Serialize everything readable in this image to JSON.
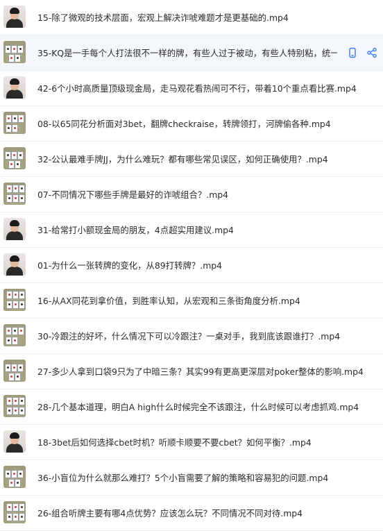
{
  "items": [
    {
      "title": "15-除了微观的技术层面，宏观上解决诈唬难题才是更基础的.mp4",
      "thumb": "presenter"
    },
    {
      "title": "35-KQ是一手每个人打法很不一样的牌，有些人过于被动，有些人特别粘，统一...",
      "thumb": "cards",
      "active": true
    },
    {
      "title": "42-6个小时高质量顶级现金局，走马观花看热闹可不行，带着10个重点看比赛.mp4",
      "thumb": "presenter"
    },
    {
      "title": "08-以65同花分析面对3bet，翻牌checkraise，转牌领打，河牌偷各种.mp4",
      "thumb": "cards"
    },
    {
      "title": "32-公认最难手牌JJ，为什么难玩？都有哪些常见误区，如何正确使用？.mp4",
      "thumb": "cards"
    },
    {
      "title": "07-不同情况下哪些手牌是最好的诈唬组合？.mp4",
      "thumb": "cards"
    },
    {
      "title": "31-给常打小额现金局的朋友，4点超实用建议.mp4",
      "thumb": "presenter"
    },
    {
      "title": "01-为什么一张转牌的变化，从89打转牌？.mp4",
      "thumb": "presenter"
    },
    {
      "title": "16-从AX同花到拿价值，到胜率认知，从宏观和三条街角度分析.mp4",
      "thumb": "cards"
    },
    {
      "title": "30-冷跟注的好坏，什么情况下可以冷跟注？一桌对手，我到底该跟谁打？.mp4",
      "thumb": "cards"
    },
    {
      "title": "27-多少人拿到口袋9只为了中暗三条？其实99有更高更深层对poker整体的影响.mp4",
      "thumb": "cards"
    },
    {
      "title": "28-几个基本道理，明白A high什么时候完全不该跟注，什么时候可以考虑抓鸡.mp4",
      "thumb": "cards"
    },
    {
      "title": "18-3bet后如何选择cbet时机？听顺卡顺要不要cbet？如何平衡？.mp4",
      "thumb": "presenter"
    },
    {
      "title": "36-小盲位为什么就那么难打？5个小盲需要了解的策略和容易犯的问题.mp4",
      "thumb": "cards"
    },
    {
      "title": "26-组合听牌主要有哪4点优势？应该怎么玩？不同情况不同对待.mp4",
      "thumb": "cards"
    }
  ],
  "actions": {
    "phone_icon": "phone-icon",
    "share_icon": "share-icon"
  },
  "colors": {
    "accent": "#3c7ef3",
    "active_bg": "#f3f6fb",
    "text": "#2b2b2b",
    "divider": "#eeeeee"
  }
}
